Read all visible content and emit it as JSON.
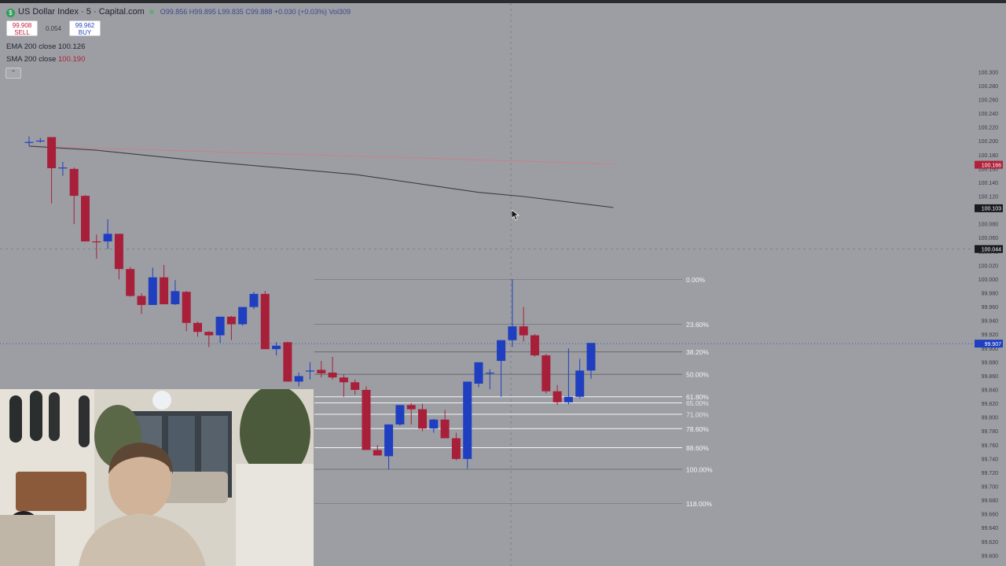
{
  "header": {
    "title": "US Dollar Index · 5 · Capital.com",
    "ohlc": "O99.856 H99.895 L99.835 C99.888 +0.030 (+0.03%) Vol309",
    "symbol_icon": "$"
  },
  "trade": {
    "sell_price": "99.908",
    "sell_label": "SELL",
    "spread": "0.054",
    "buy_price": "99.962",
    "buy_label": "BUY"
  },
  "indicators": {
    "ema_label": "EMA 200 close",
    "ema_value": "100.126",
    "sma_label": "SMA 200 close",
    "sma_value": "100.190"
  },
  "colors": {
    "background": "#9c9ea3",
    "bull": "#1f3fc0",
    "bear": "#a81f3a",
    "ema_line": "#c9808f",
    "sma_line": "#3a3f45",
    "fib_line": "#ffffff",
    "price_tag_red": "#b0223b",
    "price_tag_blue": "#1f3fc0",
    "price_tag_black": "#1a1b1f"
  },
  "chart_data": {
    "type": "candlestick",
    "symbol": "US Dollar Index",
    "timeframe": "5",
    "ylim": [
      99.585,
      100.4
    ],
    "y_ticks": [
      "100.300",
      "100.280",
      "100.260",
      "100.240",
      "100.220",
      "100.200",
      "100.180",
      "100.160",
      "100.140",
      "100.120",
      "100.100",
      "100.080",
      "100.060",
      "100.040",
      "100.020",
      "100.000",
      "99.980",
      "99.960",
      "99.940",
      "99.920",
      "99.900",
      "99.880",
      "99.860",
      "99.840",
      "99.820",
      "99.800",
      "99.780",
      "99.760",
      "99.740",
      "99.720",
      "99.700",
      "99.680",
      "99.660",
      "99.640",
      "99.620",
      "99.600"
    ],
    "candles": [
      {
        "o": 100.199,
        "h": 100.207,
        "l": 100.193,
        "c": 100.199
      },
      {
        "o": 100.2,
        "h": 100.205,
        "l": 100.198,
        "c": 100.201
      },
      {
        "o": 100.206,
        "h": 100.206,
        "l": 100.11,
        "c": 100.161
      },
      {
        "o": 100.161,
        "h": 100.17,
        "l": 100.15,
        "c": 100.162
      },
      {
        "o": 100.16,
        "h": 100.162,
        "l": 100.08,
        "c": 100.121
      },
      {
        "o": 100.121,
        "h": 100.122,
        "l": 100.055,
        "c": 100.055
      },
      {
        "o": 100.055,
        "h": 100.065,
        "l": 100.03,
        "c": 100.054
      },
      {
        "o": 100.055,
        "h": 100.087,
        "l": 100.044,
        "c": 100.066
      },
      {
        "o": 100.066,
        "h": 100.066,
        "l": 100.0,
        "c": 100.015
      },
      {
        "o": 100.015,
        "h": 100.018,
        "l": 99.975,
        "c": 99.976
      },
      {
        "o": 99.976,
        "h": 99.98,
        "l": 99.95,
        "c": 99.963
      },
      {
        "o": 99.963,
        "h": 100.017,
        "l": 99.963,
        "c": 100.003
      },
      {
        "o": 100.003,
        "h": 100.021,
        "l": 99.964,
        "c": 99.964
      },
      {
        "o": 99.964,
        "h": 99.999,
        "l": 99.963,
        "c": 99.983
      },
      {
        "o": 99.982,
        "h": 99.983,
        "l": 99.925,
        "c": 99.937
      },
      {
        "o": 99.937,
        "h": 99.939,
        "l": 99.917,
        "c": 99.924
      },
      {
        "o": 99.924,
        "h": 99.925,
        "l": 99.902,
        "c": 99.919
      },
      {
        "o": 99.919,
        "h": 99.945,
        "l": 99.908,
        "c": 99.946
      },
      {
        "o": 99.946,
        "h": 99.947,
        "l": 99.912,
        "c": 99.935
      },
      {
        "o": 99.935,
        "h": 99.96,
        "l": 99.933,
        "c": 99.96
      },
      {
        "o": 99.96,
        "h": 99.982,
        "l": 99.957,
        "c": 99.979
      },
      {
        "o": 99.979,
        "h": 99.983,
        "l": 99.899,
        "c": 99.899
      },
      {
        "o": 99.899,
        "h": 99.909,
        "l": 99.89,
        "c": 99.904
      },
      {
        "o": 99.909,
        "h": 99.91,
        "l": 99.852,
        "c": 99.852
      },
      {
        "o": 99.852,
        "h": 99.865,
        "l": 99.845,
        "c": 99.86
      },
      {
        "o": 99.868,
        "h": 99.88,
        "l": 99.855,
        "c": 99.868
      },
      {
        "o": 99.869,
        "h": 99.882,
        "l": 99.858,
        "c": 99.864
      },
      {
        "o": 99.865,
        "h": 99.888,
        "l": 99.855,
        "c": 99.858
      },
      {
        "o": 99.858,
        "h": 99.862,
        "l": 99.83,
        "c": 99.851
      },
      {
        "o": 99.851,
        "h": 99.855,
        "l": 99.833,
        "c": 99.84
      },
      {
        "o": 99.84,
        "h": 99.845,
        "l": 99.753,
        "c": 99.753
      },
      {
        "o": 99.753,
        "h": 99.76,
        "l": 99.747,
        "c": 99.745
      },
      {
        "o": 99.744,
        "h": 99.79,
        "l": 99.725,
        "c": 99.79
      },
      {
        "o": 99.79,
        "h": 99.818,
        "l": 99.788,
        "c": 99.818
      },
      {
        "o": 99.818,
        "h": 99.821,
        "l": 99.79,
        "c": 99.812
      },
      {
        "o": 99.812,
        "h": 99.82,
        "l": 99.78,
        "c": 99.784
      },
      {
        "o": 99.784,
        "h": 99.798,
        "l": 99.778,
        "c": 99.797
      },
      {
        "o": 99.797,
        "h": 99.811,
        "l": 99.77,
        "c": 99.77
      },
      {
        "o": 99.77,
        "h": 99.778,
        "l": 99.738,
        "c": 99.74
      },
      {
        "o": 99.74,
        "h": 99.852,
        "l": 99.726,
        "c": 99.852
      },
      {
        "o": 99.849,
        "h": 99.88,
        "l": 99.844,
        "c": 99.88
      },
      {
        "o": 99.864,
        "h": 99.87,
        "l": 99.841,
        "c": 99.865
      },
      {
        "o": 99.882,
        "h": 99.91,
        "l": 99.83,
        "c": 99.912
      },
      {
        "o": 99.912,
        "h": 100.0,
        "l": 99.902,
        "c": 99.932
      },
      {
        "o": 99.932,
        "h": 99.96,
        "l": 99.91,
        "c": 99.919
      },
      {
        "o": 99.919,
        "h": 99.921,
        "l": 99.888,
        "c": 99.89
      },
      {
        "o": 99.89,
        "h": 99.892,
        "l": 99.835,
        "c": 99.838
      },
      {
        "o": 99.838,
        "h": 99.847,
        "l": 99.818,
        "c": 99.822
      },
      {
        "o": 99.822,
        "h": 99.9,
        "l": 99.819,
        "c": 99.83
      },
      {
        "o": 99.83,
        "h": 99.885,
        "l": 99.828,
        "c": 99.868
      },
      {
        "o": 99.868,
        "h": 99.905,
        "l": 99.856,
        "c": 99.908
      }
    ],
    "ema_200": [
      [
        0,
        100.193
      ],
      [
        52,
        100.167
      ]
    ],
    "sma_200": [
      [
        0,
        100.193
      ],
      [
        6,
        100.187
      ],
      [
        15,
        100.172
      ],
      [
        29,
        100.152
      ],
      [
        40,
        100.126
      ],
      [
        44,
        100.12
      ],
      [
        52,
        100.104
      ]
    ],
    "fibonacci": {
      "high": 100.0,
      "low": 99.725,
      "levels": [
        {
          "ratio": 0,
          "label": "0.00%"
        },
        {
          "ratio": 0.236,
          "label": "23.60%"
        },
        {
          "ratio": 0.382,
          "label": "38.20%"
        },
        {
          "ratio": 0.5,
          "label": "50.00%"
        },
        {
          "ratio": 0.618,
          "label": "61.80%"
        },
        {
          "ratio": 0.65,
          "label": "65.00%"
        },
        {
          "ratio": 0.71,
          "label": "71.00%"
        },
        {
          "ratio": 0.786,
          "label": "78.60%"
        },
        {
          "ratio": 0.886,
          "label": "88.60%"
        },
        {
          "ratio": 1,
          "label": "100.00%"
        },
        {
          "ratio": 1.18,
          "label": "118.00%"
        }
      ]
    },
    "price_tags": [
      {
        "value": 100.166,
        "label": "100.166",
        "color": "red"
      },
      {
        "value": 100.103,
        "label": "100.103",
        "color": "black"
      },
      {
        "value": 100.044,
        "label": "100.044",
        "color": "black"
      },
      {
        "value": 99.907,
        "label": "99.907",
        "color": "blue"
      }
    ],
    "crosshair": {
      "price": 100.044
    },
    "current_price": 99.907
  }
}
